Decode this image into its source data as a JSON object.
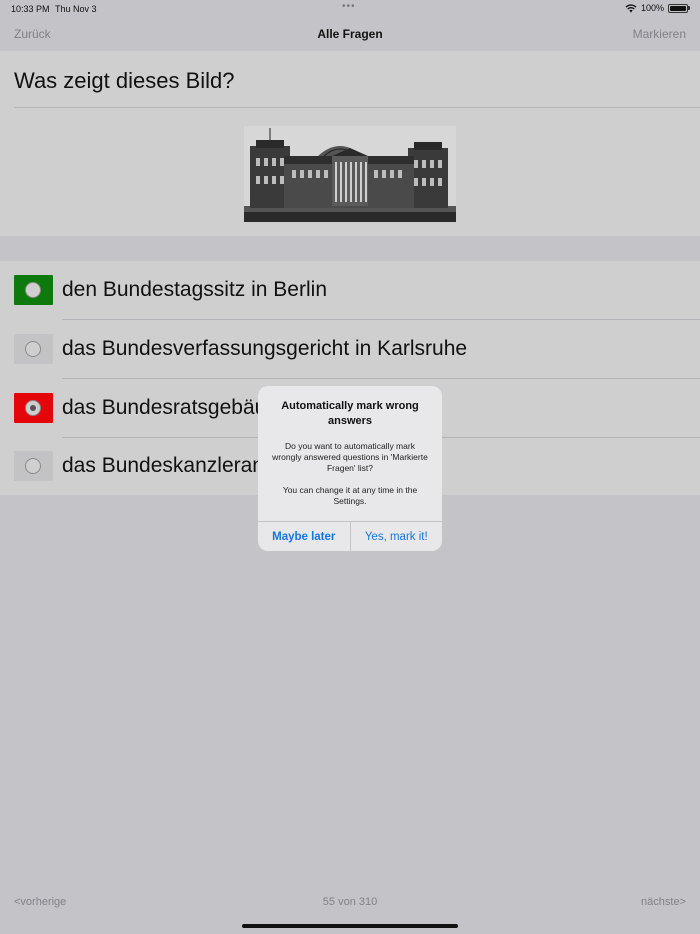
{
  "status_bar": {
    "time": "10:33 PM",
    "date": "Thu Nov 3",
    "dots": "•••",
    "battery": "100%",
    "icons": [
      "wifi-icon",
      "battery-icon"
    ]
  },
  "nav": {
    "back_label": "Zurück",
    "title": "Alle Fragen",
    "mark_label": "Markieren"
  },
  "question": {
    "text": "Was zeigt dieses Bild?"
  },
  "answers": [
    {
      "text": "den Bundestagssitz in Berlin",
      "state": "correct",
      "color": "#0e7a0d"
    },
    {
      "text": "das Bundesverfassungsgericht in Karlsruhe",
      "state": "neutral",
      "color": "#c3c3c5"
    },
    {
      "text": "das Bundesratsgebäude in Berlin",
      "state": "selected-wrong",
      "color": "#e5060a"
    },
    {
      "text": "das Bundeskanzleramt in Berlin",
      "state": "neutral",
      "color": "#c3c3c5"
    }
  ],
  "alert": {
    "title": "Automatically mark wrong answers",
    "message": "Do you want to automatically mark wrongly answered questions in 'Markierte Fragen' list?\n\nYou can change it at any time in the Settings.",
    "later_label": "Maybe later",
    "confirm_label": "Yes, mark it!",
    "accent": "#1476e0"
  },
  "footer": {
    "prev_label": "<vorherige",
    "count": "55 von 310",
    "next_label": "nächste>"
  }
}
